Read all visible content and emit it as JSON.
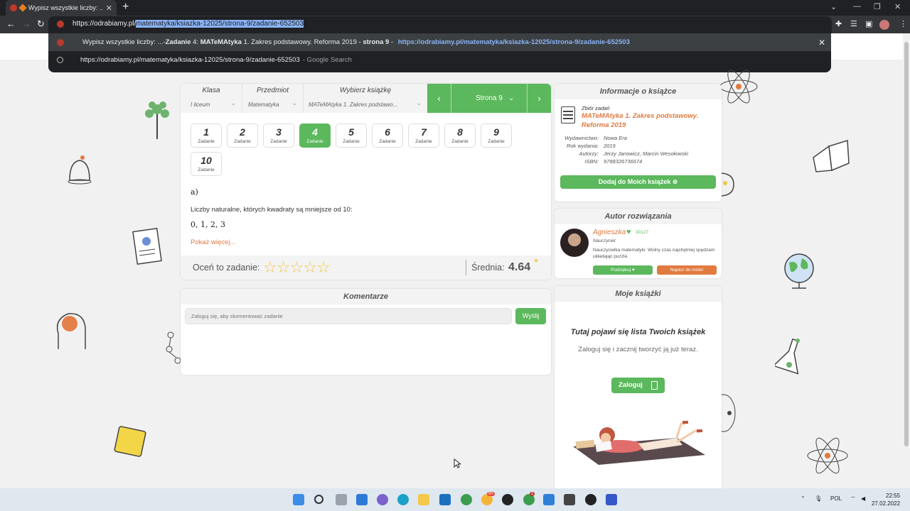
{
  "browser": {
    "tab_title": "Wypisz wszystkie liczby: ...- Z",
    "url_prefix": "https://odrabiamy.pl/",
    "url_selected": "matematyka/ksiazka-12025/strona-9/zadanie-652503",
    "suggestion_main_prefix": "Wypisz wszystkie liczby: ...- ",
    "suggestion_main_bold1": "Zadanie",
    "suggestion_main_mid": " 4: ",
    "suggestion_main_bold2": "MATeMAtyka",
    "suggestion_main_rest": " 1. Zakres podstawowy. Reforma 2019 - ",
    "suggestion_main_bold3": "strona 9",
    "suggestion_main_dash": " - ",
    "suggestion_main_link": "https://odrabiamy.pl/matematyka/ksiazka-12025/strona-9/zadanie-652503",
    "suggestion_search_text": "https://odrabiamy.pl/matematyka/ksiazka-12025/strona-9/zadanie-652503",
    "suggestion_search_suffix": "- Google Search"
  },
  "filters": {
    "klasa_label": "Klasa",
    "klasa_value": "I liceum",
    "przedmiot_label": "Przedmiot",
    "przedmiot_value": "Matematyka",
    "ksiazka_label": "Wybierz książkę",
    "ksiazka_value": "MATeMAtyka 1. Zakres podstawo...",
    "page_label": "Strona 9"
  },
  "tasks": [
    {
      "num": "1",
      "sub": "Zadanie"
    },
    {
      "num": "2",
      "sub": "Zadanie"
    },
    {
      "num": "3",
      "sub": "Zadanie"
    },
    {
      "num": "4",
      "sub": "Zadanie"
    },
    {
      "num": "5",
      "sub": "Zadanie"
    },
    {
      "num": "6",
      "sub": "Zadanie"
    },
    {
      "num": "7",
      "sub": "Zadanie"
    },
    {
      "num": "8",
      "sub": "Zadanie"
    },
    {
      "num": "9",
      "sub": "Zadanie"
    },
    {
      "num": "10",
      "sub": "Zadanie"
    }
  ],
  "active_task": "4",
  "solution": {
    "part": "a)",
    "text": "Liczby naturalne, których kwadraty są mniejsze od 10:",
    "math": "0, 1, 2, 3",
    "show_more": "Pokaż więcej..."
  },
  "rating": {
    "label": "Oceń to zadanie:",
    "stars": 5,
    "avg_label": "Średnia:",
    "avg_value": "4.64"
  },
  "comments": {
    "title": "Komentarze",
    "placeholder": "Zaloguj się, aby skomentować zadanie",
    "send": "Wyślij"
  },
  "book_info": {
    "title": "Informacje o książce",
    "kind": "Zbiór zadań",
    "book_title": "MATeMAtyka 1. Zakres podstawowy. Reforma 2019",
    "publisher_k": "Wydawnictwo:",
    "publisher_v": "Nowa Era",
    "year_k": "Rok wydania:",
    "year_v": "2019",
    "authors_k": "Autorzy:",
    "authors_v": "Jerzy Janowicz, Marcin Wesołowski",
    "isbn_k": "ISBN:",
    "isbn_v": "9788326736674",
    "add_button": "Dodaj do Moich książek"
  },
  "author": {
    "title": "Autor rozwiązania",
    "name": "Agnieszka",
    "likes": "30127",
    "role": "Nauczyciel",
    "bio": "Nauczycielka matematyki. Wolny czas najchętniej spędzam układając puzzle.",
    "thanks": "Podziękuj ♥",
    "write": "Napisz do mnie!"
  },
  "my_books": {
    "title": "Moje książki",
    "heading": "Tutaj pojawi się lista Twoich książek",
    "sub": "Zaloguj się i zacznij tworzyć ją już teraz.",
    "login": "Zaloguj"
  },
  "taskbar": {
    "lang": "POL",
    "time": "22:55",
    "date": "27.02.2022",
    "badge1": "9+",
    "badge2": "1"
  },
  "colors": {
    "accent_green": "#5cb85c",
    "accent_orange": "#e07a3f",
    "star": "#f0c64a"
  }
}
